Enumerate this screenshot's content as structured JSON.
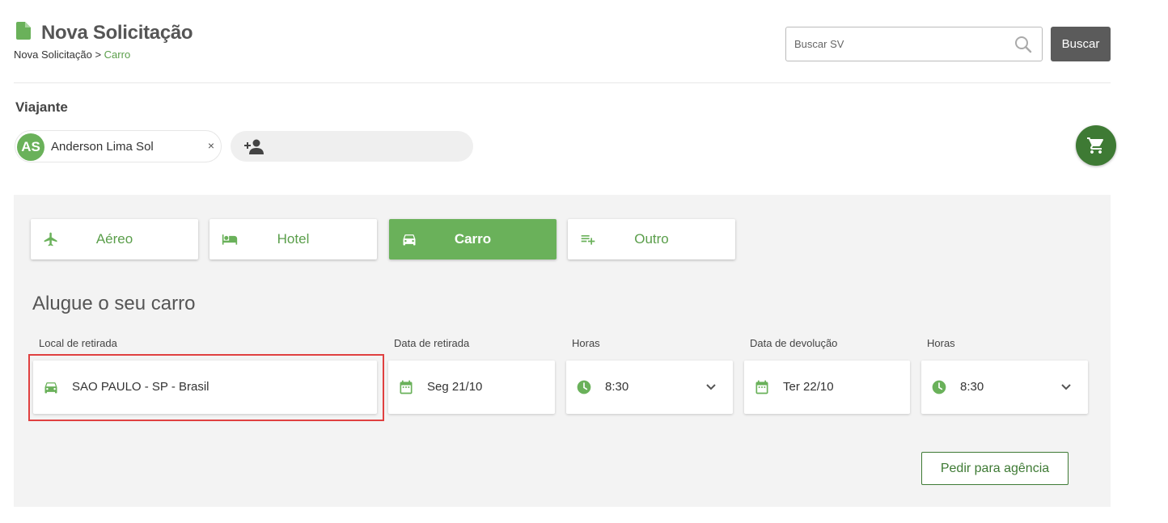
{
  "header": {
    "title": "Nova Solicitação",
    "breadcrumb": {
      "parent": "Nova Solicitação",
      "separator": ">",
      "current": "Carro"
    }
  },
  "search": {
    "placeholder": "Buscar SV",
    "button_label": "Buscar"
  },
  "traveler": {
    "section_label": "Viajante",
    "initials": "AS",
    "name": "Anderson Lima Sol",
    "remove_symbol": "×"
  },
  "tabs": [
    {
      "label": "Aéreo",
      "icon": "airplane-icon",
      "active": false
    },
    {
      "label": "Hotel",
      "icon": "bed-icon",
      "active": false
    },
    {
      "label": "Carro",
      "icon": "car-icon",
      "active": true
    },
    {
      "label": "Outro",
      "icon": "playlist-add-icon",
      "active": false
    }
  ],
  "form": {
    "title": "Alugue o seu carro",
    "pickup_location": {
      "label": "Local de retirada",
      "value": "SAO PAULO - SP - Brasil",
      "icon": "car-icon"
    },
    "pickup_date": {
      "label": "Data de retirada",
      "value": "Seg 21/10",
      "icon": "calendar-icon"
    },
    "pickup_time": {
      "label": "Horas",
      "value": "8:30",
      "icon": "clock-icon"
    },
    "return_date": {
      "label": "Data de devolução",
      "value": "Ter 22/10",
      "icon": "calendar-icon"
    },
    "return_time": {
      "label": "Horas",
      "value": "8:30",
      "icon": "clock-icon"
    },
    "agency_button": "Pedir para agência"
  },
  "colors": {
    "accent_green": "#6ab15a",
    "dark_green": "#3e7a34",
    "highlight_red": "#e04040",
    "search_button": "#5b5b5b"
  }
}
